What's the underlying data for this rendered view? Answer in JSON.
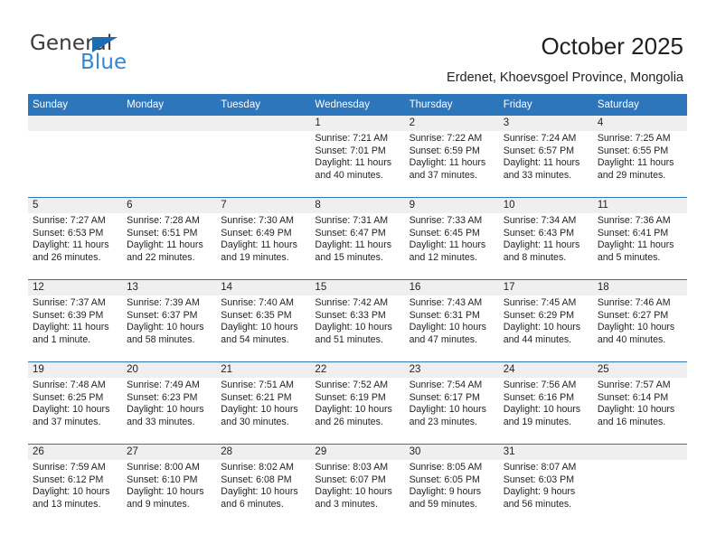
{
  "brand": {
    "name_part1": "General",
    "name_part2": "Blue",
    "triangle_color": "#1b6cb0",
    "blue_text_color": "#2f87d6"
  },
  "header": {
    "title": "October 2025",
    "subtitle": "Erdenet, Khoevsgoel Province, Mongolia",
    "accent_color": "#2e76bc",
    "daynum_band_color": "#efefef"
  },
  "weekdays": [
    "Sunday",
    "Monday",
    "Tuesday",
    "Wednesday",
    "Thursday",
    "Friday",
    "Saturday"
  ],
  "calendar": {
    "month": "October",
    "year": "2025",
    "weeks": [
      [
        {
          "day": "",
          "lines": []
        },
        {
          "day": "",
          "lines": []
        },
        {
          "day": "",
          "lines": []
        },
        {
          "day": "1",
          "lines": [
            "Sunrise: 7:21 AM",
            "Sunset: 7:01 PM",
            "Daylight: 11 hours",
            "and 40 minutes."
          ]
        },
        {
          "day": "2",
          "lines": [
            "Sunrise: 7:22 AM",
            "Sunset: 6:59 PM",
            "Daylight: 11 hours",
            "and 37 minutes."
          ]
        },
        {
          "day": "3",
          "lines": [
            "Sunrise: 7:24 AM",
            "Sunset: 6:57 PM",
            "Daylight: 11 hours",
            "and 33 minutes."
          ]
        },
        {
          "day": "4",
          "lines": [
            "Sunrise: 7:25 AM",
            "Sunset: 6:55 PM",
            "Daylight: 11 hours",
            "and 29 minutes."
          ]
        }
      ],
      [
        {
          "day": "5",
          "lines": [
            "Sunrise: 7:27 AM",
            "Sunset: 6:53 PM",
            "Daylight: 11 hours",
            "and 26 minutes."
          ]
        },
        {
          "day": "6",
          "lines": [
            "Sunrise: 7:28 AM",
            "Sunset: 6:51 PM",
            "Daylight: 11 hours",
            "and 22 minutes."
          ]
        },
        {
          "day": "7",
          "lines": [
            "Sunrise: 7:30 AM",
            "Sunset: 6:49 PM",
            "Daylight: 11 hours",
            "and 19 minutes."
          ]
        },
        {
          "day": "8",
          "lines": [
            "Sunrise: 7:31 AM",
            "Sunset: 6:47 PM",
            "Daylight: 11 hours",
            "and 15 minutes."
          ]
        },
        {
          "day": "9",
          "lines": [
            "Sunrise: 7:33 AM",
            "Sunset: 6:45 PM",
            "Daylight: 11 hours",
            "and 12 minutes."
          ]
        },
        {
          "day": "10",
          "lines": [
            "Sunrise: 7:34 AM",
            "Sunset: 6:43 PM",
            "Daylight: 11 hours",
            "and 8 minutes."
          ]
        },
        {
          "day": "11",
          "lines": [
            "Sunrise: 7:36 AM",
            "Sunset: 6:41 PM",
            "Daylight: 11 hours",
            "and 5 minutes."
          ]
        }
      ],
      [
        {
          "day": "12",
          "lines": [
            "Sunrise: 7:37 AM",
            "Sunset: 6:39 PM",
            "Daylight: 11 hours",
            "and 1 minute."
          ]
        },
        {
          "day": "13",
          "lines": [
            "Sunrise: 7:39 AM",
            "Sunset: 6:37 PM",
            "Daylight: 10 hours",
            "and 58 minutes."
          ]
        },
        {
          "day": "14",
          "lines": [
            "Sunrise: 7:40 AM",
            "Sunset: 6:35 PM",
            "Daylight: 10 hours",
            "and 54 minutes."
          ]
        },
        {
          "day": "15",
          "lines": [
            "Sunrise: 7:42 AM",
            "Sunset: 6:33 PM",
            "Daylight: 10 hours",
            "and 51 minutes."
          ]
        },
        {
          "day": "16",
          "lines": [
            "Sunrise: 7:43 AM",
            "Sunset: 6:31 PM",
            "Daylight: 10 hours",
            "and 47 minutes."
          ]
        },
        {
          "day": "17",
          "lines": [
            "Sunrise: 7:45 AM",
            "Sunset: 6:29 PM",
            "Daylight: 10 hours",
            "and 44 minutes."
          ]
        },
        {
          "day": "18",
          "lines": [
            "Sunrise: 7:46 AM",
            "Sunset: 6:27 PM",
            "Daylight: 10 hours",
            "and 40 minutes."
          ]
        }
      ],
      [
        {
          "day": "19",
          "lines": [
            "Sunrise: 7:48 AM",
            "Sunset: 6:25 PM",
            "Daylight: 10 hours",
            "and 37 minutes."
          ]
        },
        {
          "day": "20",
          "lines": [
            "Sunrise: 7:49 AM",
            "Sunset: 6:23 PM",
            "Daylight: 10 hours",
            "and 33 minutes."
          ]
        },
        {
          "day": "21",
          "lines": [
            "Sunrise: 7:51 AM",
            "Sunset: 6:21 PM",
            "Daylight: 10 hours",
            "and 30 minutes."
          ]
        },
        {
          "day": "22",
          "lines": [
            "Sunrise: 7:52 AM",
            "Sunset: 6:19 PM",
            "Daylight: 10 hours",
            "and 26 minutes."
          ]
        },
        {
          "day": "23",
          "lines": [
            "Sunrise: 7:54 AM",
            "Sunset: 6:17 PM",
            "Daylight: 10 hours",
            "and 23 minutes."
          ]
        },
        {
          "day": "24",
          "lines": [
            "Sunrise: 7:56 AM",
            "Sunset: 6:16 PM",
            "Daylight: 10 hours",
            "and 19 minutes."
          ]
        },
        {
          "day": "25",
          "lines": [
            "Sunrise: 7:57 AM",
            "Sunset: 6:14 PM",
            "Daylight: 10 hours",
            "and 16 minutes."
          ]
        }
      ],
      [
        {
          "day": "26",
          "lines": [
            "Sunrise: 7:59 AM",
            "Sunset: 6:12 PM",
            "Daylight: 10 hours",
            "and 13 minutes."
          ]
        },
        {
          "day": "27",
          "lines": [
            "Sunrise: 8:00 AM",
            "Sunset: 6:10 PM",
            "Daylight: 10 hours",
            "and 9 minutes."
          ]
        },
        {
          "day": "28",
          "lines": [
            "Sunrise: 8:02 AM",
            "Sunset: 6:08 PM",
            "Daylight: 10 hours",
            "and 6 minutes."
          ]
        },
        {
          "day": "29",
          "lines": [
            "Sunrise: 8:03 AM",
            "Sunset: 6:07 PM",
            "Daylight: 10 hours",
            "and 3 minutes."
          ]
        },
        {
          "day": "30",
          "lines": [
            "Sunrise: 8:05 AM",
            "Sunset: 6:05 PM",
            "Daylight: 9 hours",
            "and 59 minutes."
          ]
        },
        {
          "day": "31",
          "lines": [
            "Sunrise: 8:07 AM",
            "Sunset: 6:03 PM",
            "Daylight: 9 hours",
            "and 56 minutes."
          ]
        },
        {
          "day": "",
          "lines": []
        }
      ]
    ]
  }
}
